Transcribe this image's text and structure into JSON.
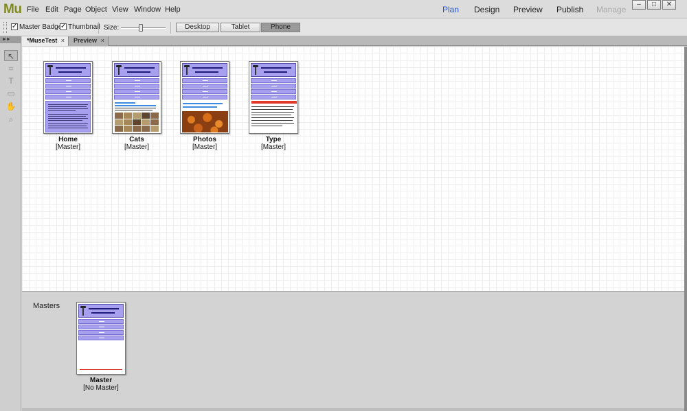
{
  "app": {
    "logo": "Mu",
    "menu": [
      "File",
      "Edit",
      "Page",
      "Object",
      "View",
      "Window",
      "Help"
    ],
    "modes": [
      {
        "label": "Plan",
        "state": "active"
      },
      {
        "label": "Design",
        "state": "normal"
      },
      {
        "label": "Preview",
        "state": "normal"
      },
      {
        "label": "Publish",
        "state": "normal"
      },
      {
        "label": "Manage",
        "state": "disabled"
      }
    ],
    "window_buttons": {
      "minimize": "–",
      "maximize": "□",
      "close": "✕"
    }
  },
  "toolbar": {
    "master_badge": {
      "label": "Master Badge",
      "checked": true,
      "mark": "✓"
    },
    "thumbnail": {
      "label": "Thumbnail",
      "checked": true,
      "mark": "✓"
    },
    "size_label": "Size:",
    "size_level": 0.45,
    "devices": [
      {
        "label": "Desktop",
        "active": false
      },
      {
        "label": "Tablet",
        "active": false
      },
      {
        "label": "Phone",
        "active": true
      }
    ]
  },
  "tabs": [
    {
      "label": "*MuseTest",
      "active": true,
      "close": "×"
    },
    {
      "label": "Preview",
      "active": false,
      "close": "×"
    }
  ],
  "tools": [
    "selection-tool-icon",
    "crop-tool-icon",
    "text-tool-icon",
    "rectangle-tool-icon",
    "hand-tool-icon",
    "zoom-tool-icon"
  ],
  "tool_glyphs": [
    "↖",
    "⌗",
    "T",
    "▭",
    "✋",
    "⌕"
  ],
  "pages": [
    {
      "name": "Home",
      "master": "[Master]",
      "variant": "home"
    },
    {
      "name": "Cats",
      "master": "[Master]",
      "variant": "cats"
    },
    {
      "name": "Photos",
      "master": "[Master]",
      "variant": "photos"
    },
    {
      "name": "Type",
      "master": "[Master]",
      "variant": "type"
    }
  ],
  "masters": {
    "label": "Masters",
    "items": [
      {
        "name": "Master",
        "master": "[No Master]"
      }
    ]
  },
  "colors": {
    "header_purple": "#a6a0ee",
    "plan_blue": "#2a55c9",
    "logo_olive": "#7f8a1c",
    "type_red": "#e23a2a"
  }
}
